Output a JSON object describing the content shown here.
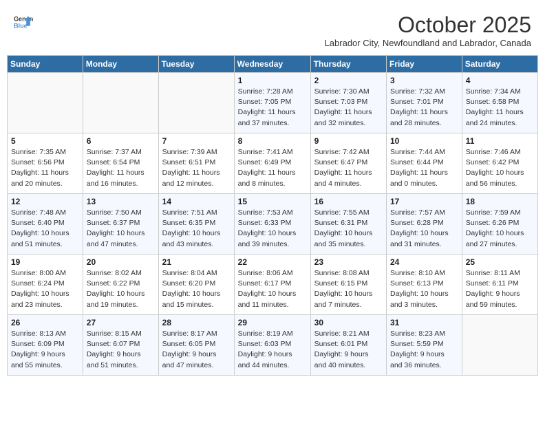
{
  "header": {
    "logo_line1": "General",
    "logo_line2": "Blue",
    "month_year": "October 2025",
    "subtitle": "Labrador City, Newfoundland and Labrador, Canada"
  },
  "weekdays": [
    "Sunday",
    "Monday",
    "Tuesday",
    "Wednesday",
    "Thursday",
    "Friday",
    "Saturday"
  ],
  "weeks": [
    [
      {
        "day": "",
        "info": ""
      },
      {
        "day": "",
        "info": ""
      },
      {
        "day": "",
        "info": ""
      },
      {
        "day": "1",
        "info": "Sunrise: 7:28 AM\nSunset: 7:05 PM\nDaylight: 11 hours\nand 37 minutes."
      },
      {
        "day": "2",
        "info": "Sunrise: 7:30 AM\nSunset: 7:03 PM\nDaylight: 11 hours\nand 32 minutes."
      },
      {
        "day": "3",
        "info": "Sunrise: 7:32 AM\nSunset: 7:01 PM\nDaylight: 11 hours\nand 28 minutes."
      },
      {
        "day": "4",
        "info": "Sunrise: 7:34 AM\nSunset: 6:58 PM\nDaylight: 11 hours\nand 24 minutes."
      }
    ],
    [
      {
        "day": "5",
        "info": "Sunrise: 7:35 AM\nSunset: 6:56 PM\nDaylight: 11 hours\nand 20 minutes."
      },
      {
        "day": "6",
        "info": "Sunrise: 7:37 AM\nSunset: 6:54 PM\nDaylight: 11 hours\nand 16 minutes."
      },
      {
        "day": "7",
        "info": "Sunrise: 7:39 AM\nSunset: 6:51 PM\nDaylight: 11 hours\nand 12 minutes."
      },
      {
        "day": "8",
        "info": "Sunrise: 7:41 AM\nSunset: 6:49 PM\nDaylight: 11 hours\nand 8 minutes."
      },
      {
        "day": "9",
        "info": "Sunrise: 7:42 AM\nSunset: 6:47 PM\nDaylight: 11 hours\nand 4 minutes."
      },
      {
        "day": "10",
        "info": "Sunrise: 7:44 AM\nSunset: 6:44 PM\nDaylight: 11 hours\nand 0 minutes."
      },
      {
        "day": "11",
        "info": "Sunrise: 7:46 AM\nSunset: 6:42 PM\nDaylight: 10 hours\nand 56 minutes."
      }
    ],
    [
      {
        "day": "12",
        "info": "Sunrise: 7:48 AM\nSunset: 6:40 PM\nDaylight: 10 hours\nand 51 minutes."
      },
      {
        "day": "13",
        "info": "Sunrise: 7:50 AM\nSunset: 6:37 PM\nDaylight: 10 hours\nand 47 minutes."
      },
      {
        "day": "14",
        "info": "Sunrise: 7:51 AM\nSunset: 6:35 PM\nDaylight: 10 hours\nand 43 minutes."
      },
      {
        "day": "15",
        "info": "Sunrise: 7:53 AM\nSunset: 6:33 PM\nDaylight: 10 hours\nand 39 minutes."
      },
      {
        "day": "16",
        "info": "Sunrise: 7:55 AM\nSunset: 6:31 PM\nDaylight: 10 hours\nand 35 minutes."
      },
      {
        "day": "17",
        "info": "Sunrise: 7:57 AM\nSunset: 6:28 PM\nDaylight: 10 hours\nand 31 minutes."
      },
      {
        "day": "18",
        "info": "Sunrise: 7:59 AM\nSunset: 6:26 PM\nDaylight: 10 hours\nand 27 minutes."
      }
    ],
    [
      {
        "day": "19",
        "info": "Sunrise: 8:00 AM\nSunset: 6:24 PM\nDaylight: 10 hours\nand 23 minutes."
      },
      {
        "day": "20",
        "info": "Sunrise: 8:02 AM\nSunset: 6:22 PM\nDaylight: 10 hours\nand 19 minutes."
      },
      {
        "day": "21",
        "info": "Sunrise: 8:04 AM\nSunset: 6:20 PM\nDaylight: 10 hours\nand 15 minutes."
      },
      {
        "day": "22",
        "info": "Sunrise: 8:06 AM\nSunset: 6:17 PM\nDaylight: 10 hours\nand 11 minutes."
      },
      {
        "day": "23",
        "info": "Sunrise: 8:08 AM\nSunset: 6:15 PM\nDaylight: 10 hours\nand 7 minutes."
      },
      {
        "day": "24",
        "info": "Sunrise: 8:10 AM\nSunset: 6:13 PM\nDaylight: 10 hours\nand 3 minutes."
      },
      {
        "day": "25",
        "info": "Sunrise: 8:11 AM\nSunset: 6:11 PM\nDaylight: 9 hours\nand 59 minutes."
      }
    ],
    [
      {
        "day": "26",
        "info": "Sunrise: 8:13 AM\nSunset: 6:09 PM\nDaylight: 9 hours\nand 55 minutes."
      },
      {
        "day": "27",
        "info": "Sunrise: 8:15 AM\nSunset: 6:07 PM\nDaylight: 9 hours\nand 51 minutes."
      },
      {
        "day": "28",
        "info": "Sunrise: 8:17 AM\nSunset: 6:05 PM\nDaylight: 9 hours\nand 47 minutes."
      },
      {
        "day": "29",
        "info": "Sunrise: 8:19 AM\nSunset: 6:03 PM\nDaylight: 9 hours\nand 44 minutes."
      },
      {
        "day": "30",
        "info": "Sunrise: 8:21 AM\nSunset: 6:01 PM\nDaylight: 9 hours\nand 40 minutes."
      },
      {
        "day": "31",
        "info": "Sunrise: 8:23 AM\nSunset: 5:59 PM\nDaylight: 9 hours\nand 36 minutes."
      },
      {
        "day": "",
        "info": ""
      }
    ]
  ]
}
